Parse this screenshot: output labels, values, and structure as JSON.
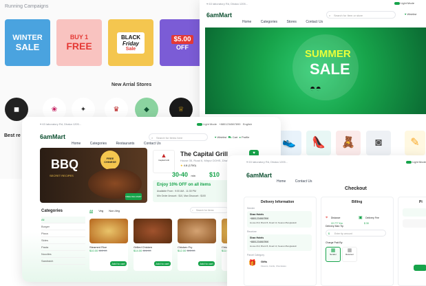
{
  "back_left": {
    "section_title": "Running Campaigns",
    "campaigns": [
      {
        "line1": "WINTER",
        "line2": "SALE",
        "bg": "#4aa3df",
        "fg": "#ffffff"
      },
      {
        "line1": "BUY 1",
        "line2": "FREE",
        "bg": "#f9c3c0",
        "fg": "#e53935"
      },
      {
        "line1": "BLACK",
        "line2": "Friday",
        "line3": "Sale",
        "bg": "#f4c64f",
        "fg": "#111111"
      },
      {
        "line1": "$5.00",
        "line2": "OFF",
        "bg": "#7b5cd6",
        "fg": "#ffffff"
      }
    ],
    "stores_title": "New Arrial Stores",
    "best_label": "Best re"
  },
  "back_right": {
    "address": "63 laboratory Rd, Dhaka 1205...",
    "light_mode": "Light Mode",
    "logo": "6amMart",
    "nav": [
      "Home",
      "Categories",
      "Stores",
      "Contact Us"
    ],
    "search_placeholder": "Search for Item or store",
    "wishlist_label": "Wishlist",
    "banner": {
      "line1": "SUMMER",
      "line2": "SALE"
    }
  },
  "middle": {
    "address": "63 laboratory Rd, Dhaka 1205...",
    "light_mode": "Light Mode",
    "phone": "+8801234567890",
    "language": "English",
    "logo": "6amMart",
    "nav": [
      "Home",
      "Categories",
      "Restaurants",
      "Contact Us"
    ],
    "search_placeholder": "Search for items here",
    "icons": [
      "Wishlist",
      "Cart",
      "Profile"
    ],
    "promo": {
      "title": "BBQ",
      "subtitle": "SECRET RECIPES",
      "badge": "FREE CHINESE",
      "free_delivery": "FREE DELIVERY"
    },
    "restaurant": {
      "name": "The Capital Grill",
      "address": "House 35, Road 6, Mirpur DOHS, Dhaka",
      "rating": "4.8 (1700)",
      "logo_text": "Capital Grill",
      "delivery_time": "30-40",
      "delivery_unit": "min",
      "delivery_label": "Delivery Time",
      "min_order": "$10",
      "min_order_label": "Minimum Order Amount"
    },
    "offer": {
      "title": "Enjoy 10% OFF on all items",
      "line1": "Available From : 9:00 AM - 11:30 PM",
      "line2": "Min Order Amount : $10, Max Discount : $100"
    },
    "categories_title": "Categories",
    "categories": [
      "All",
      "Burger",
      "Pizza",
      "Sides",
      "Pasta",
      "Noodles",
      "Sandwich"
    ],
    "tabs": [
      "All",
      "Veg",
      "Non-Veg"
    ],
    "search_items_placeholder": "Search for items",
    "food_items": [
      {
        "name": "Steamed Rice",
        "price": "$10.00",
        "old_price": "$12.00",
        "cart": "Add to cart"
      },
      {
        "name": "Grilled Chicken",
        "price": "$14.00",
        "old_price": "$16.00",
        "cart": "Add to cart"
      },
      {
        "name": "Chicken Fry",
        "price": "$12.00",
        "old_price": "$15.00",
        "cart": "Add to cart"
      },
      {
        "name": "Chicken Biryani",
        "price": "$11.00",
        "old_price": "$13.00",
        "cart": "Add to cart"
      }
    ]
  },
  "front": {
    "address": "63 laboratory Rd, Dhaka 1205...",
    "light_mode": "Light Mode",
    "logo": "6amMart",
    "nav": [
      "Home",
      "Contact Us"
    ],
    "title": "Checkout",
    "delivery_info": {
      "title": "Delivery Information",
      "sender_label": "Sender",
      "sender_name": "Shan Hotels",
      "sender_phone": "+8801234567890",
      "sender_address": "House #13, Block B, Road 10, Nearest Bangladesh",
      "receiver_label": "Receiver",
      "receiver_name": "Shan Hotels",
      "receiver_phone": "+8801234567890",
      "receiver_address": "House #13, Block B, Road 10, Nearest Bangladesh",
      "parcel_label": "Parcel Category",
      "parcel_name": "Gifts",
      "parcel_desc": "Flowers, Cards, Chocolates"
    },
    "billing": {
      "title": "Billing",
      "distance_label": "Distance",
      "distance_value": "22.777 Km",
      "delivery_fee_label": "Delivery Fee",
      "delivery_fee_value": "$ 30",
      "instruction_label": "Delivery Man Tip",
      "tip_placeholder": "Enter tip amount",
      "charge_label": "Charge Paid By",
      "payer_sender": "Sender",
      "payer_receiver": "Receiver"
    },
    "third_col_label": "Pi"
  }
}
